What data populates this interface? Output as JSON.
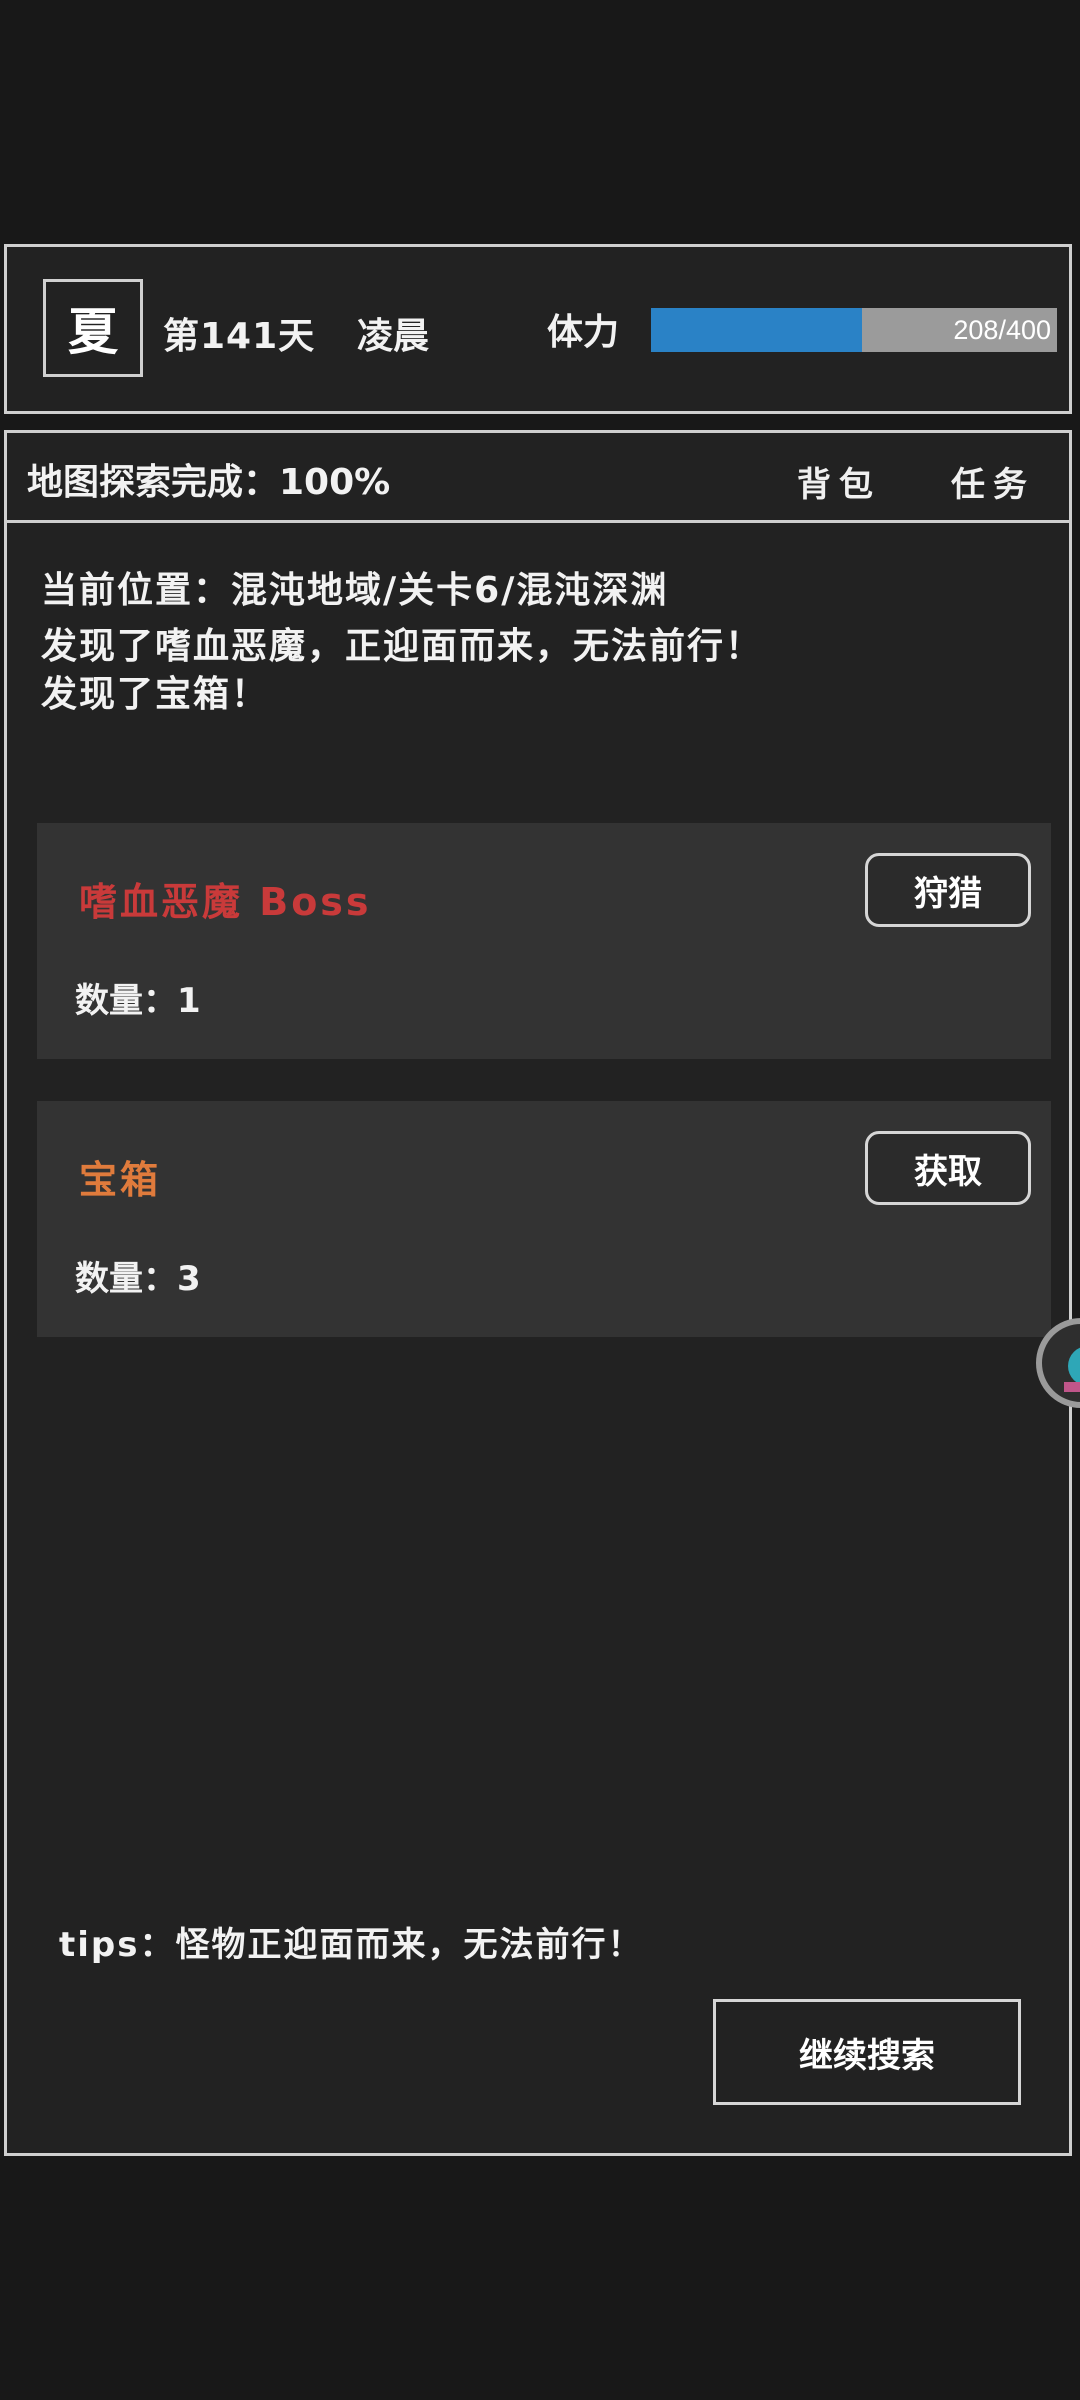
{
  "header": {
    "season": "夏",
    "day": "第141天",
    "time_of_day": "凌晨",
    "stamina_label": "体力",
    "stamina_value": "208/400",
    "stamina_fraction": 0.52,
    "stamina_color": "#2a82c6"
  },
  "topbar": {
    "explore": "地图探索完成：100%",
    "bag": "背包",
    "tasks": "任务"
  },
  "log": [
    "当前位置：混沌地域/关卡6/混沌深渊",
    "发现了嗜血恶魔，正迎面而来，无法前行！",
    "发现了宝箱！"
  ],
  "cards": [
    {
      "title": "嗜血恶魔 Boss",
      "title_color": "#c93a3a",
      "count": "数量：1",
      "button": "狩猎"
    },
    {
      "title": "宝箱",
      "title_color": "#e07b3c",
      "count": "数量：3",
      "button": "获取"
    }
  ],
  "tips": "tips：怪物正迎面而来，无法前行！",
  "continue_button": "继续搜索",
  "icons": {
    "floating": "assistant-bubble-icon"
  }
}
